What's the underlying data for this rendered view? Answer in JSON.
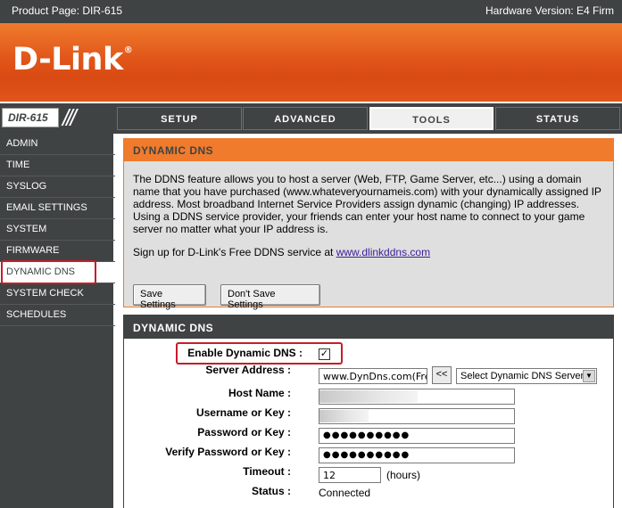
{
  "topbar": {
    "product_page": "Product Page: DIR-615",
    "hardware_version": "Hardware Version: E4  Firm"
  },
  "brand": {
    "logo_text": "D-Link",
    "trademark": "®"
  },
  "nav": {
    "model": "DIR-615",
    "slashes": "///",
    "tabs": [
      {
        "label": "SETUP"
      },
      {
        "label": "ADVANCED"
      },
      {
        "label": "TOOLS",
        "active": true
      },
      {
        "label": "STATUS"
      }
    ]
  },
  "sidebar": {
    "items": [
      {
        "label": "ADMIN"
      },
      {
        "label": "TIME"
      },
      {
        "label": "SYSLOG"
      },
      {
        "label": "EMAIL SETTINGS"
      },
      {
        "label": "SYSTEM"
      },
      {
        "label": "FIRMWARE"
      },
      {
        "label": "DYNAMIC DNS",
        "active": true
      },
      {
        "label": "SYSTEM CHECK"
      },
      {
        "label": "SCHEDULES"
      }
    ]
  },
  "intro": {
    "title": "DYNAMIC DNS",
    "description": "The DDNS feature allows you to host a server (Web, FTP, Game Server, etc...) using a domain name that you have purchased (www.whateveryournameis.com) with your dynamically assigned IP address. Most broadband Internet Service Providers assign dynamic (changing) IP addresses. Using a DDNS service provider, your friends can enter your host name to connect to your game server no matter what your IP address is.",
    "signup_text": "Sign up for D-Link's Free DDNS service at ",
    "signup_link": "www.dlinkddns.com",
    "save_button": "Save Settings",
    "dont_save_button": "Don't Save Settings"
  },
  "form": {
    "title": "DYNAMIC DNS",
    "enable_label": "Enable Dynamic DNS :",
    "enable_checked": true,
    "enable_check_mark": "✓",
    "server_address_label": "Server Address :",
    "server_address_value": "www.DynDns.com(Free)",
    "copy_button": "<<",
    "server_select_value": "Select Dynamic DNS Server",
    "select_arrow": "▼",
    "host_name_label": "Host Name :",
    "username_label": "Username or Key :",
    "password_label": "Password or Key :",
    "password_value": "●●●●●●●●●●",
    "verify_password_label": "Verify Password or Key :",
    "verify_password_value": "●●●●●●●●●●",
    "timeout_label": "Timeout :",
    "timeout_value": "12",
    "timeout_unit": "(hours)",
    "status_label": "Status :",
    "status_value": "Connected"
  }
}
